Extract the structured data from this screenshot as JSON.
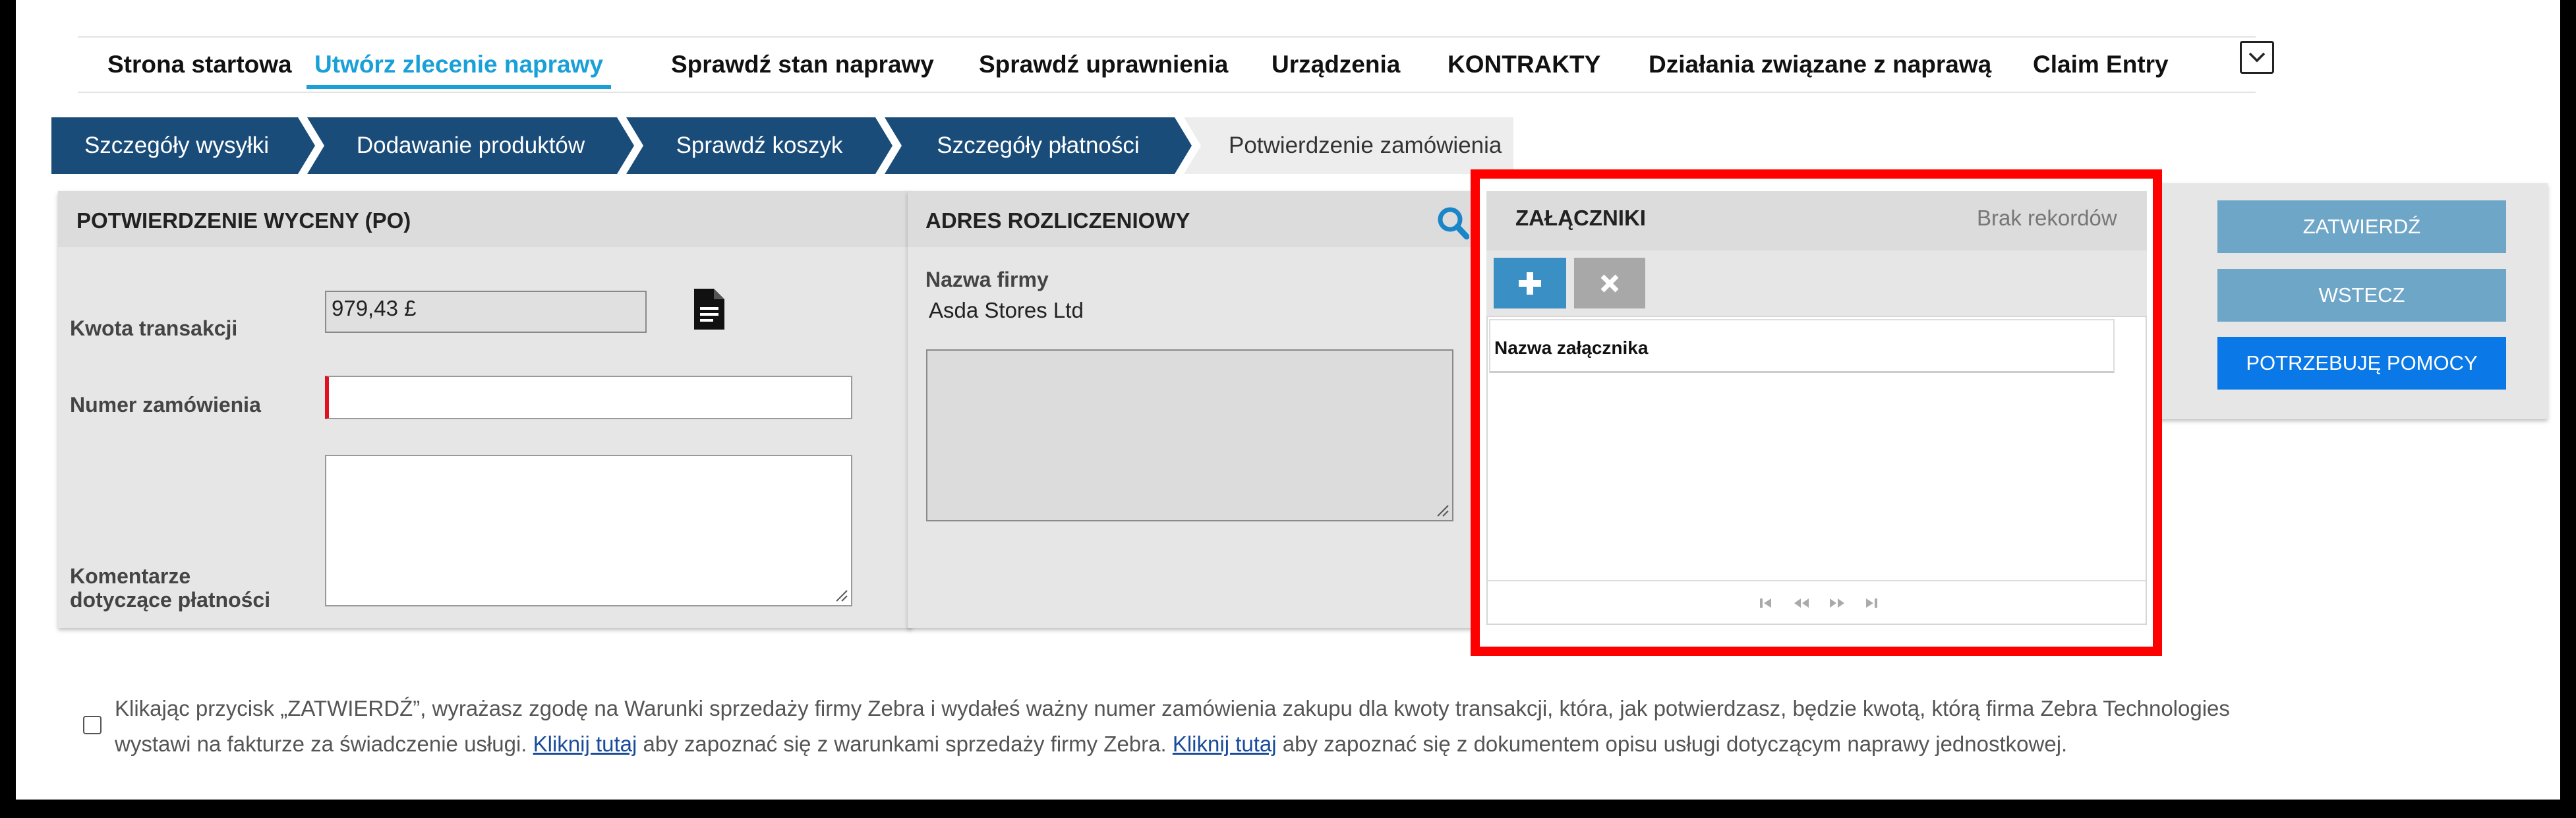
{
  "nav": {
    "tabs": [
      {
        "label": "Strona startowa"
      },
      {
        "label": "Utwórz zlecenie naprawy"
      },
      {
        "label": "Sprawdź stan naprawy"
      },
      {
        "label": "Sprawdź uprawnienia"
      },
      {
        "label": "Urządzenia"
      },
      {
        "label": "KONTRAKTY"
      },
      {
        "label": "Działania związane z naprawą"
      },
      {
        "label": "Claim Entry"
      }
    ],
    "more_icon": "chevron-down-icon"
  },
  "steps": [
    {
      "label": "Szczegóły wysyłki"
    },
    {
      "label": "Dodawanie produktów"
    },
    {
      "label": "Sprawdź koszyk"
    },
    {
      "label": "Szczegóły płatności"
    },
    {
      "label": "Potwierdzenie zamówienia"
    }
  ],
  "po_panel": {
    "title": "POTWIERDZENIE WYCENY (PO)",
    "amount_label": "Kwota transakcji",
    "amount_value": "979,43 £",
    "order_label": "Numer zamówienia",
    "order_value": "",
    "comments_label_line1": "Komentarze",
    "comments_label_line2": "dotyczące płatności",
    "comments_value": "",
    "doc_icon": "document-icon"
  },
  "billing_panel": {
    "title": "ADRES ROZLICZENIOWY",
    "search_icon": "search-icon",
    "company_label": "Nazwa firmy",
    "company_value": "Asda Stores Ltd",
    "address_value": ""
  },
  "attachments_panel": {
    "title": "ZAŁĄCZNIKI",
    "no_records": "Brak rekordów",
    "add_icon": "plus-icon",
    "remove_icon": "close-icon",
    "column_header": "Nazwa załącznika",
    "pager_icons": [
      "first-page-icon",
      "prev-page-icon",
      "next-page-icon",
      "last-page-icon"
    ],
    "highlight_color": "#ff0000"
  },
  "actions": {
    "approve": "ZATWIERDŹ",
    "back": "WSTECZ",
    "help": "POTRZEBUJĘ POMOCY"
  },
  "agreement": {
    "checked": false,
    "text_part1": "Klikając przycisk „ZATWIERDŹ”, wyrażasz zgodę na Warunki sprzedaży firmy Zebra i wydałeś ważny numer zamówienia zakupu dla kwoty transakcji, która, jak potwierdzasz, będzie kwotą, którą firma Zebra Technologies wystawi na fakturze za świadczenie usługi. ",
    "link1": "Kliknij tutaj",
    "text_part2": " aby zapoznać się z warunkami sprzedaży firmy Zebra. ",
    "link2": "Kliknij tutaj",
    "text_part3": " aby zapoznać się z dokumentem opisu usługi dotyczącym naprawy jednostkowej."
  },
  "colors": {
    "nav_active": "#1aa0d8",
    "step_bg": "#1a4c79",
    "action_button": "#6ea6c8",
    "help_button": "#0a78e6",
    "icon_blue": "#1a86c8"
  }
}
